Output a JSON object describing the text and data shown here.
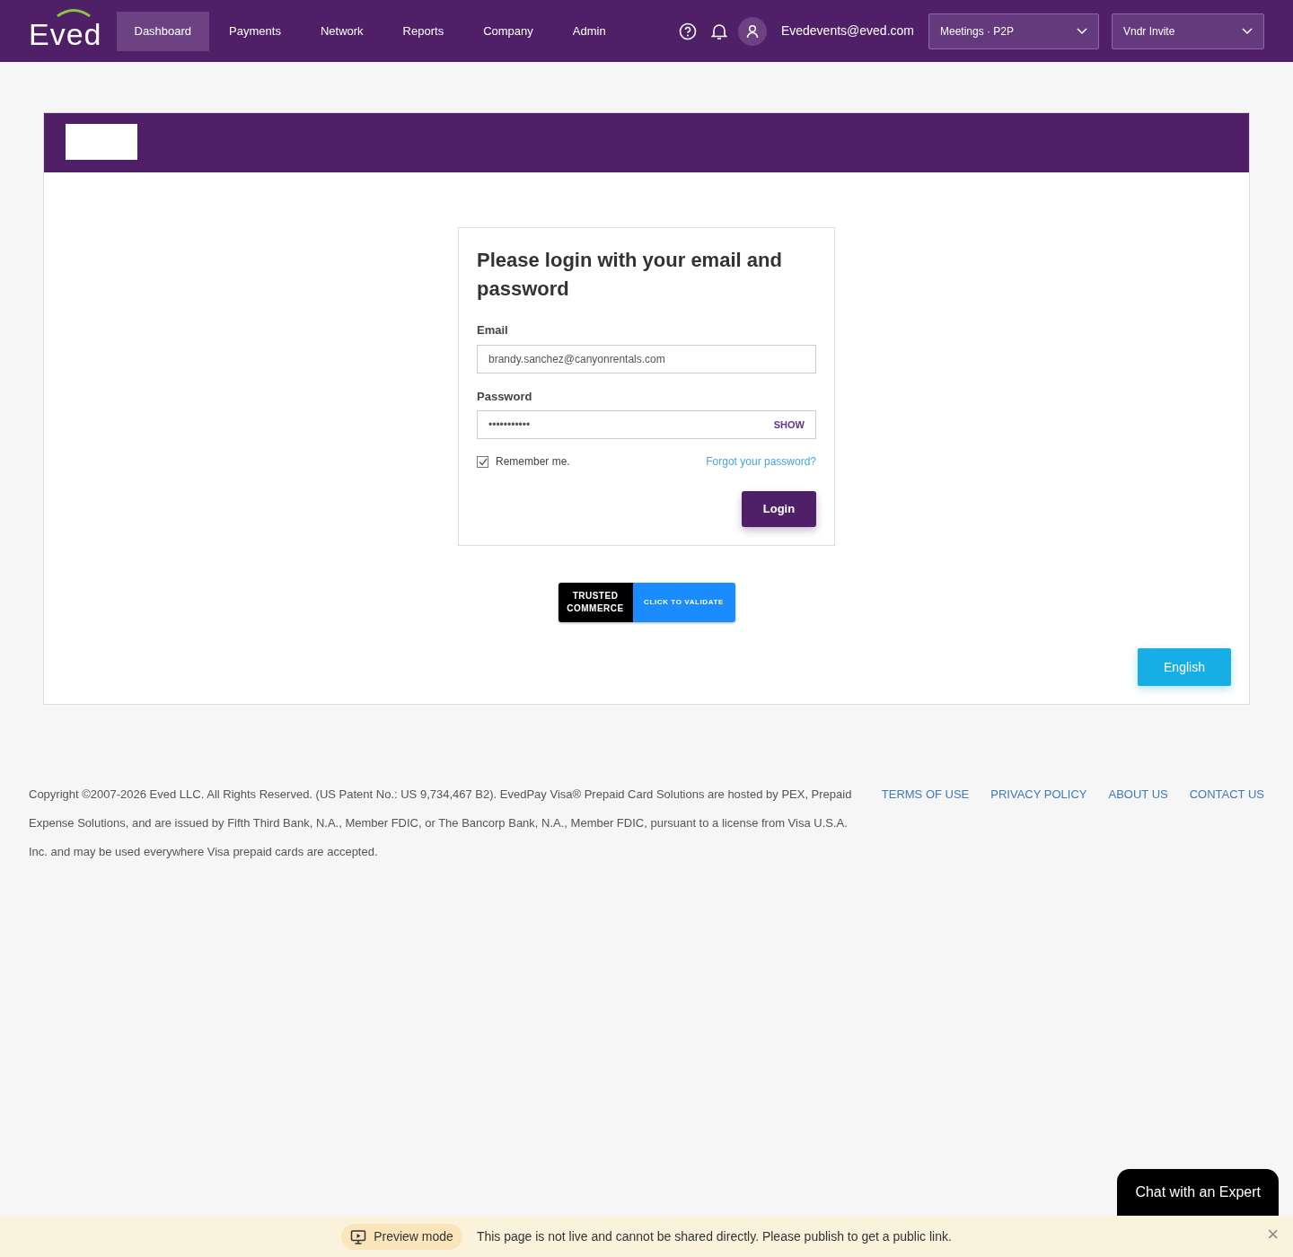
{
  "brand": "Eved",
  "nav": [
    {
      "label": "Dashboard",
      "selected": true
    },
    {
      "label": "Payments",
      "selected": false
    },
    {
      "label": "Network",
      "selected": false
    },
    {
      "label": "Reports",
      "selected": false
    },
    {
      "label": "Company",
      "selected": false
    },
    {
      "label": "Admin",
      "selected": false
    }
  ],
  "user_email": "Evedevents@eved.com",
  "selects": [
    {
      "value": "Meetings · P2P"
    },
    {
      "value": "Vndr Invite"
    }
  ],
  "login": {
    "title": "Please login with your email and password",
    "email_label": "Email",
    "email_value": "brandy.sanchez@canyonrentals.com",
    "password_label": "Password",
    "password_value": "•••••••••••",
    "show": "SHOW",
    "remember": {
      "label": "Remember me.",
      "checked": true
    },
    "forgot": "Forgot your password?",
    "submit": "Login"
  },
  "trust_badge": {
    "left": [
      "TRUSTED",
      "COMMERCE"
    ],
    "right": "CLICK TO VALIDATE"
  },
  "language": "English",
  "footer": {
    "copyright": "Copyright ©2007-2026 Eved LLC. All Rights Reserved. (US Patent No.: US 9,734,467 B2). EvedPay Visa® Prepaid Card Solutions are hosted by PEX, Prepaid Expense Solutions, and are issued by Fifth Third Bank, N.A., Member FDIC, or The Bancorp Bank, N.A., Member FDIC, pursuant to a license from Visa U.S.A. Inc. and may be used everywhere Visa prepaid cards are accepted.",
    "links": [
      "TERMS OF USE",
      "PRIVACY POLICY",
      "ABOUT US",
      "CONTACT US"
    ]
  },
  "chat_button": "Chat with an Expert",
  "preview_bar": {
    "badge": "Preview mode",
    "message": "This page is not live and cannot be shared directly. Please publish to get a public link.",
    "close": "×"
  }
}
